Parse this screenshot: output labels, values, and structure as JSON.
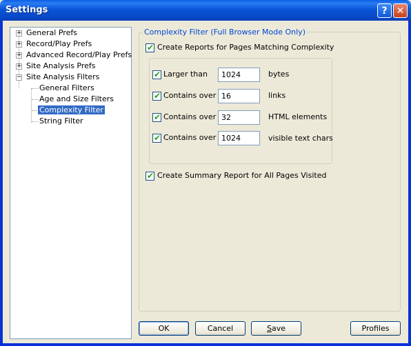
{
  "window": {
    "title": "Settings",
    "help_glyph": "?",
    "close_glyph": "✕"
  },
  "tree": {
    "items": [
      {
        "label": "General Prefs",
        "expander": "+"
      },
      {
        "label": "Record/Play Prefs",
        "expander": "+"
      },
      {
        "label": "Advanced Record/Play Prefs",
        "expander": "+"
      },
      {
        "label": "Site Analysis Prefs",
        "expander": "+"
      },
      {
        "label": "Site Analysis Filters",
        "expander": "−"
      }
    ],
    "children": [
      {
        "label": "General Filters"
      },
      {
        "label": "Age and Size Filters"
      },
      {
        "label": "Complexity Filter",
        "selected": true
      },
      {
        "label": "String Filter"
      }
    ]
  },
  "panel": {
    "legend": "Complexity Filter (Full Browser Mode Only)",
    "create_reports_label": "Create Reports for Pages Matching Complexity",
    "create_reports_checked": true,
    "criteria": [
      {
        "label": "Larger than",
        "value": "1024",
        "unit": "bytes",
        "checked": true
      },
      {
        "label": "Contains over",
        "value": "16",
        "unit": "links",
        "checked": true
      },
      {
        "label": "Contains over",
        "value": "32",
        "unit": "HTML elements",
        "checked": true
      },
      {
        "label": "Contains over",
        "value": "1024",
        "unit": "visible text chars",
        "checked": true
      }
    ],
    "summary_label": "Create Summary Report for All Pages Visited",
    "summary_checked": true
  },
  "buttons": {
    "ok": "OK",
    "cancel": "Cancel",
    "save_first": "S",
    "save_rest": "ave",
    "profiles": "Profiles"
  },
  "check_glyph": "✔"
}
